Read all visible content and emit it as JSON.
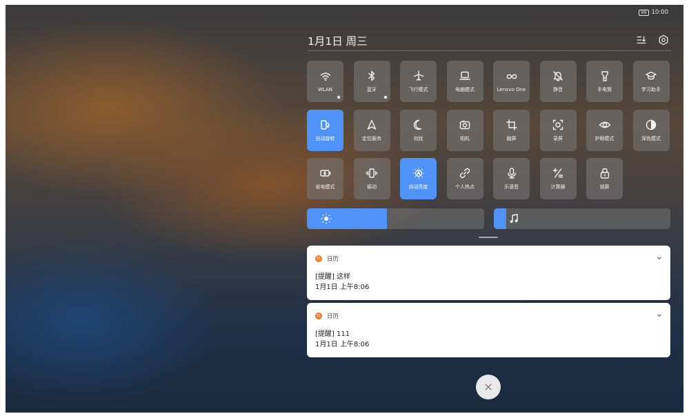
{
  "status_bar": {
    "battery": "99",
    "time": "10:00"
  },
  "header": {
    "date": "1月1日 周三"
  },
  "tiles": [
    {
      "label": "WLAN",
      "icon": "wifi-icon",
      "active": false,
      "dot": true
    },
    {
      "label": "蓝牙",
      "icon": "bluetooth-icon",
      "active": false,
      "dot": true
    },
    {
      "label": "飞行模式",
      "icon": "airplane-icon",
      "active": false,
      "dot": false
    },
    {
      "label": "电脑模式",
      "icon": "laptop-icon",
      "active": false,
      "dot": false
    },
    {
      "label": "Lenovo One",
      "icon": "infinity-icon",
      "active": false,
      "dot": false
    },
    {
      "label": "静音",
      "icon": "bell-off-icon",
      "active": false,
      "dot": false
    },
    {
      "label": "手电筒",
      "icon": "flashlight-icon",
      "active": false,
      "dot": false
    },
    {
      "label": "学习助手",
      "icon": "graduation-cap-icon",
      "active": false,
      "dot": false
    },
    {
      "label": "自动旋转",
      "icon": "auto-rotate-icon",
      "active": true,
      "dot": false
    },
    {
      "label": "定位服务",
      "icon": "location-arrow-icon",
      "active": false,
      "dot": false
    },
    {
      "label": "勿扰",
      "icon": "moon-icon",
      "active": false,
      "dot": false
    },
    {
      "label": "相机",
      "icon": "camera-icon",
      "active": false,
      "dot": false
    },
    {
      "label": "截屏",
      "icon": "crop-icon",
      "active": false,
      "dot": false
    },
    {
      "label": "录屏",
      "icon": "screen-record-icon",
      "active": false,
      "dot": false
    },
    {
      "label": "护眼模式",
      "icon": "eye-icon",
      "active": false,
      "dot": false
    },
    {
      "label": "深色模式",
      "icon": "contrast-icon",
      "active": false,
      "dot": false
    },
    {
      "label": "省电模式",
      "icon": "battery-saver-icon",
      "active": false,
      "dot": false
    },
    {
      "label": "振动",
      "icon": "vibrate-icon",
      "active": false,
      "dot": false
    },
    {
      "label": "自动亮度",
      "icon": "auto-brightness-icon",
      "active": true,
      "dot": false
    },
    {
      "label": "个人热点",
      "icon": "hotspot-link-icon",
      "active": false,
      "dot": false
    },
    {
      "label": "乐语音",
      "icon": "microphone-icon",
      "active": false,
      "dot": false
    },
    {
      "label": "计算器",
      "icon": "calculator-icon",
      "active": false,
      "dot": false
    },
    {
      "label": "锁屏",
      "icon": "lock-icon",
      "active": false,
      "dot": false
    }
  ],
  "sliders": {
    "brightness": {
      "icon": "sun-icon",
      "level": 0.45
    },
    "volume": {
      "icon": "music-note-icon",
      "level": 0.07
    }
  },
  "notifications": [
    {
      "app": "日历",
      "title": "[提醒] 这样",
      "time": "1月1日 上午8:06"
    },
    {
      "app": "日历",
      "title": "[提醒] 111",
      "time": "1月1日 上午8:06"
    }
  ],
  "colors": {
    "accent": "#4f92f8",
    "tile_bg": "#747474",
    "calendar_icon": "#f07c2a"
  }
}
